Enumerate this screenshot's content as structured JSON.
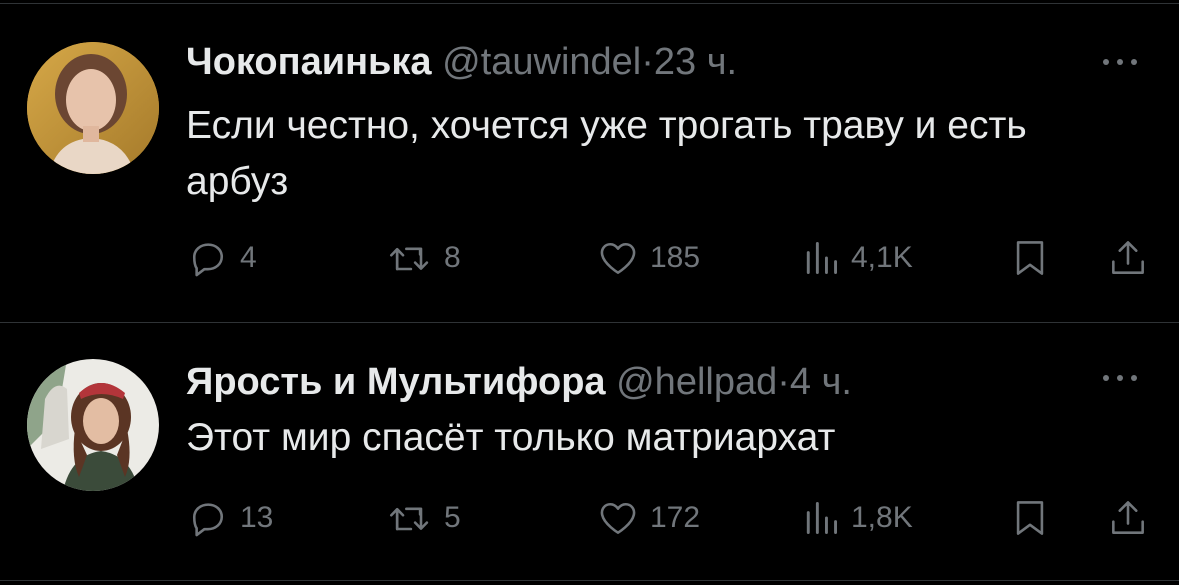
{
  "colors": {
    "background": "#000000",
    "text_primary": "#e7e9ea",
    "text_secondary": "#71767b",
    "divider": "#2f3336"
  },
  "tweets": [
    {
      "display_name": "Чокопаинька",
      "handle": "@tauwindel",
      "separator": "·",
      "time": "23 ч.",
      "text": "Если честно, хочется уже трогать траву и есть арбуз",
      "replies": "4",
      "retweets": "8",
      "likes": "185",
      "views": "4,1K"
    },
    {
      "display_name": "Ярость и Мультифора",
      "handle": "@hellpad",
      "separator": "·",
      "time": "4 ч.",
      "text": "Этот мир спасёт только матриархат",
      "replies": "13",
      "retweets": "5",
      "likes": "172",
      "views": "1,8K"
    }
  ],
  "icons": {
    "reply": "reply-bubble-icon",
    "retweet": "retweet-icon",
    "like": "heart-icon",
    "views": "views-bar-chart-icon",
    "bookmark": "bookmark-icon",
    "share": "share-upload-icon",
    "more": "more-dots-icon"
  }
}
